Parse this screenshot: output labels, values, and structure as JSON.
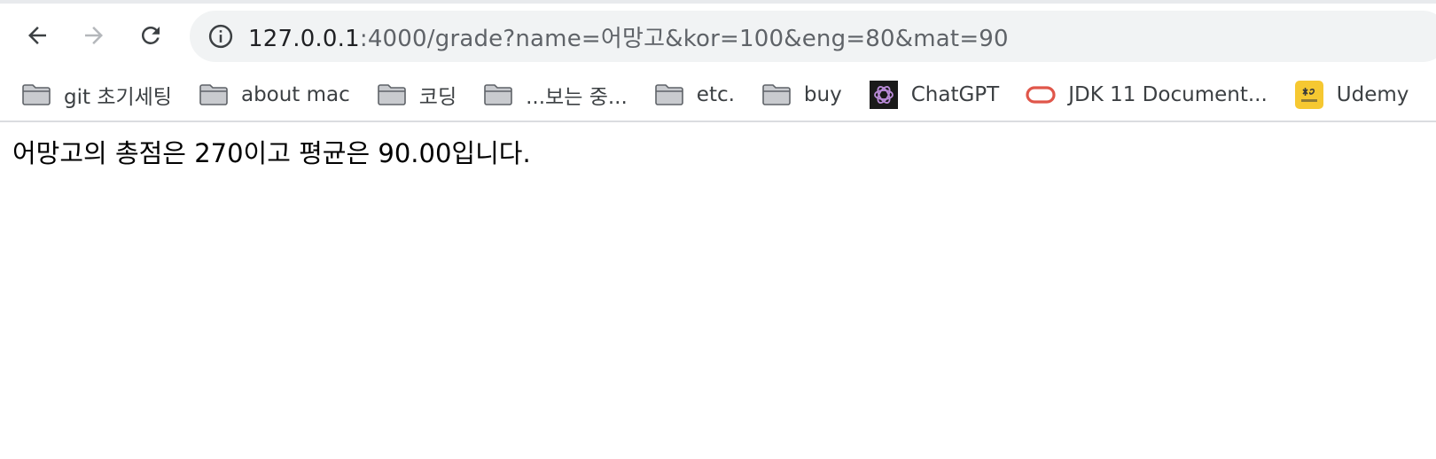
{
  "browser": {
    "url_host": "127.0.0.1",
    "url_rest": ":4000/grade?name=어망고&kor=100&eng=80&mat=90"
  },
  "bookmarks": [
    {
      "label": "git 초기세팅",
      "icon": "folder-icon"
    },
    {
      "label": "about mac",
      "icon": "folder-icon"
    },
    {
      "label": "코딩",
      "icon": "folder-icon"
    },
    {
      "label": "...보는 중...",
      "icon": "folder-icon"
    },
    {
      "label": "etc.",
      "icon": "folder-icon"
    },
    {
      "label": "buy",
      "icon": "folder-icon"
    },
    {
      "label": "ChatGPT",
      "icon": "chatgpt-icon"
    },
    {
      "label": "JDK 11 Document...",
      "icon": "oracle-icon"
    },
    {
      "label": "Udemy",
      "icon": "kb-bank-icon"
    }
  ],
  "page": {
    "result_text": "어망고의 총점은 270이고 평균은 90.00입니다."
  }
}
